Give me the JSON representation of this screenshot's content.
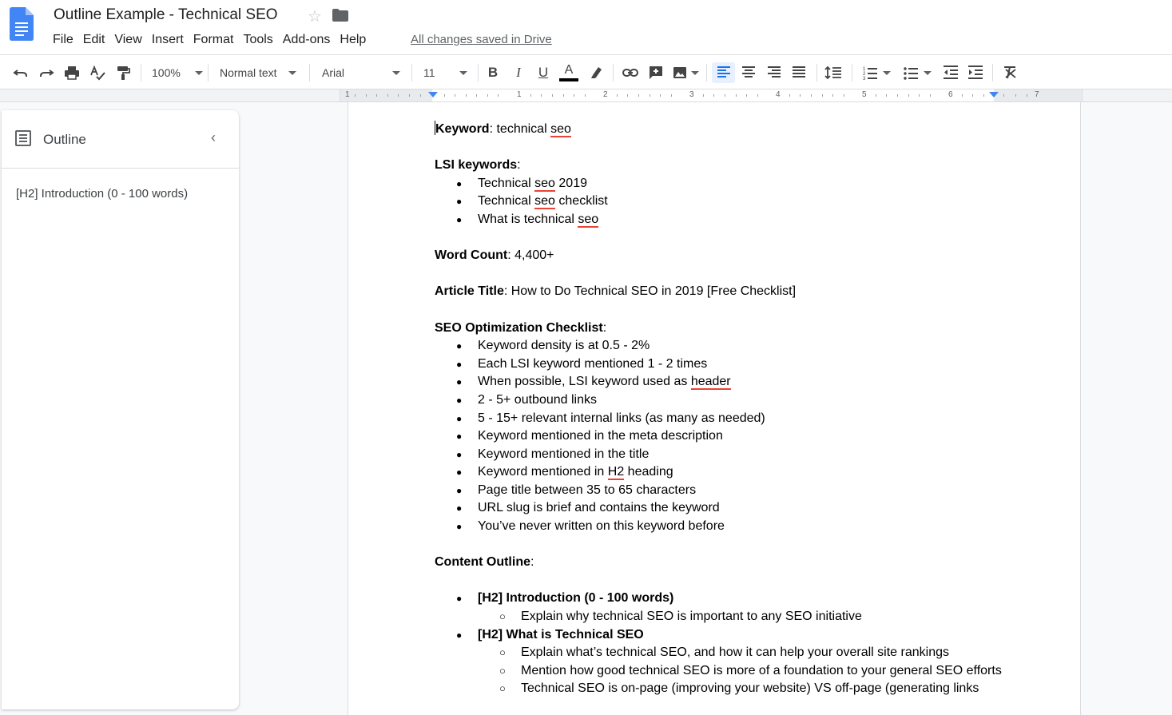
{
  "app": {
    "title": "Outline Example - Technical SEO",
    "saved_status": "All changes saved in Drive"
  },
  "menu": [
    "File",
    "Edit",
    "View",
    "Insert",
    "Format",
    "Tools",
    "Add-ons",
    "Help"
  ],
  "toolbar": {
    "zoom": "100%",
    "style": "Normal text",
    "font": "Arial",
    "font_size": "11",
    "icons": [
      "undo-icon",
      "redo-icon",
      "print-icon",
      "spellcheck-icon",
      "paint-format-icon",
      "bold-icon",
      "italic-icon",
      "underline-icon",
      "text-color-icon",
      "highlight-icon",
      "link-icon",
      "comment-icon",
      "image-icon",
      "align-left-icon",
      "align-center-icon",
      "align-right-icon",
      "justify-icon",
      "line-spacing-icon",
      "numbered-list-icon",
      "bulleted-list-icon",
      "decrease-indent-icon",
      "increase-indent-icon",
      "clear-formatting-icon"
    ],
    "text_color": "#000000"
  },
  "ruler": {
    "numbers": [
      "1",
      "1",
      "2",
      "3",
      "4",
      "5",
      "6",
      "7"
    ]
  },
  "outline": {
    "title": "Outline",
    "items": [
      "[H2] Introduction (0 - 100 words)"
    ]
  },
  "doc": {
    "keyword_label": "Keyword",
    "keyword_value": "technical ",
    "keyword_value_sp": "seo",
    "lsi_label": "LSI keywords",
    "lsi": [
      {
        "a": "Technical ",
        "sp": "seo",
        "b": " 2019"
      },
      {
        "a": "Technical ",
        "sp": "seo",
        "b": " checklist"
      },
      {
        "a": "What is technical ",
        "sp": "seo",
        "b": ""
      }
    ],
    "word_count_label": "Word Count",
    "word_count_value": "4,400+",
    "article_title_label": "Article Title",
    "article_title_value": "How to Do Technical SEO in 2019 [Free Checklist]",
    "checklist_label": "SEO Optimization Checklist",
    "checklist": [
      {
        "a": "Keyword density is at 0.5 - 2%",
        "sp": "",
        "b": ""
      },
      {
        "a": "Each LSI keyword mentioned 1 - 2 times",
        "sp": "",
        "b": ""
      },
      {
        "a": "When possible, LSI keyword used as ",
        "sp": "header",
        "b": ""
      },
      {
        "a": "2 - 5+ outbound links",
        "sp": "",
        "b": ""
      },
      {
        "a": "5 - 15+ relevant internal links (as many as needed)",
        "sp": "",
        "b": ""
      },
      {
        "a": "Keyword mentioned in the meta description",
        "sp": "",
        "b": ""
      },
      {
        "a": "Keyword mentioned in the title",
        "sp": "",
        "b": ""
      },
      {
        "a": "Keyword mentioned in ",
        "sp": "H2",
        "b": " heading"
      },
      {
        "a": "Page title between 35 to 65 characters",
        "sp": "",
        "b": ""
      },
      {
        "a": "URL slug is brief and contains the keyword",
        "sp": "",
        "b": ""
      },
      {
        "a": "You’ve never written on this keyword before",
        "sp": "",
        "b": ""
      }
    ],
    "content_outline_label": "Content Outline",
    "outline_sections": [
      {
        "heading": "[H2] Introduction (0 - 100 words)",
        "points": [
          "Explain why technical SEO is important to any SEO initiative"
        ]
      },
      {
        "heading": "[H2] What is Technical SEO",
        "points": [
          "Explain what’s technical SEO, and how it can help your overall site rankings",
          "Mention how good technical SEO is more of a foundation to your general SEO efforts",
          "Technical SEO is on-page (improving your website) VS off-page (generating links"
        ]
      }
    ]
  }
}
